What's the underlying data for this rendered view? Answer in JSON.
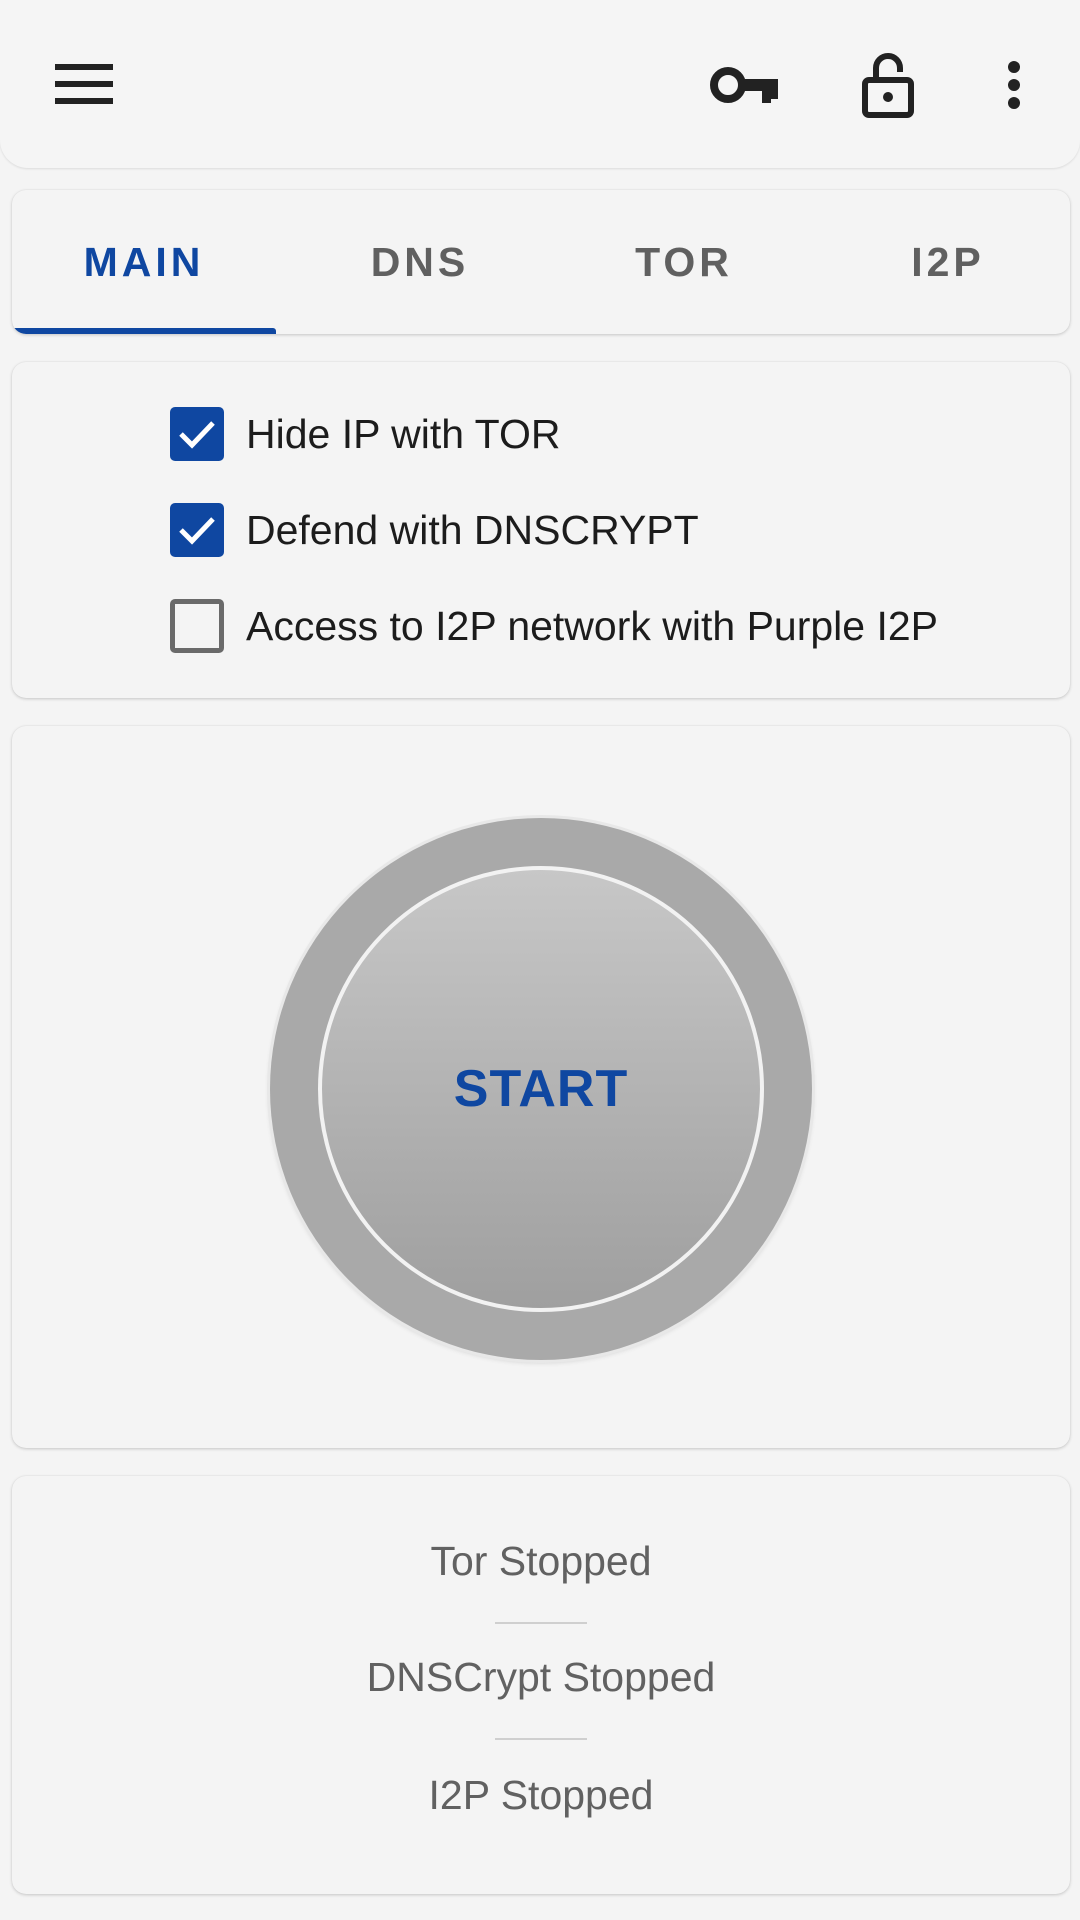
{
  "toolbar": {
    "icons": [
      "menu-icon",
      "vpn-key-icon",
      "lock-open-icon",
      "more-vert-icon"
    ]
  },
  "tabs": [
    {
      "label": "MAIN",
      "active": true
    },
    {
      "label": "DNS",
      "active": false
    },
    {
      "label": "TOR",
      "active": false
    },
    {
      "label": "I2P",
      "active": false
    }
  ],
  "options": [
    {
      "label": "Hide IP with TOR",
      "checked": true
    },
    {
      "label": "Defend with DNSCRYPT",
      "checked": true
    },
    {
      "label": "Access to I2P network with Purple I2P",
      "checked": false
    }
  ],
  "start_button": {
    "label": "START"
  },
  "status": {
    "tor": "Tor Stopped",
    "dnscrypt": "DNSCrypt Stopped",
    "i2p": "I2P Stopped"
  },
  "colors": {
    "accent": "#0f47a1",
    "background": "#f4f4f4",
    "status_text": "#616161"
  }
}
